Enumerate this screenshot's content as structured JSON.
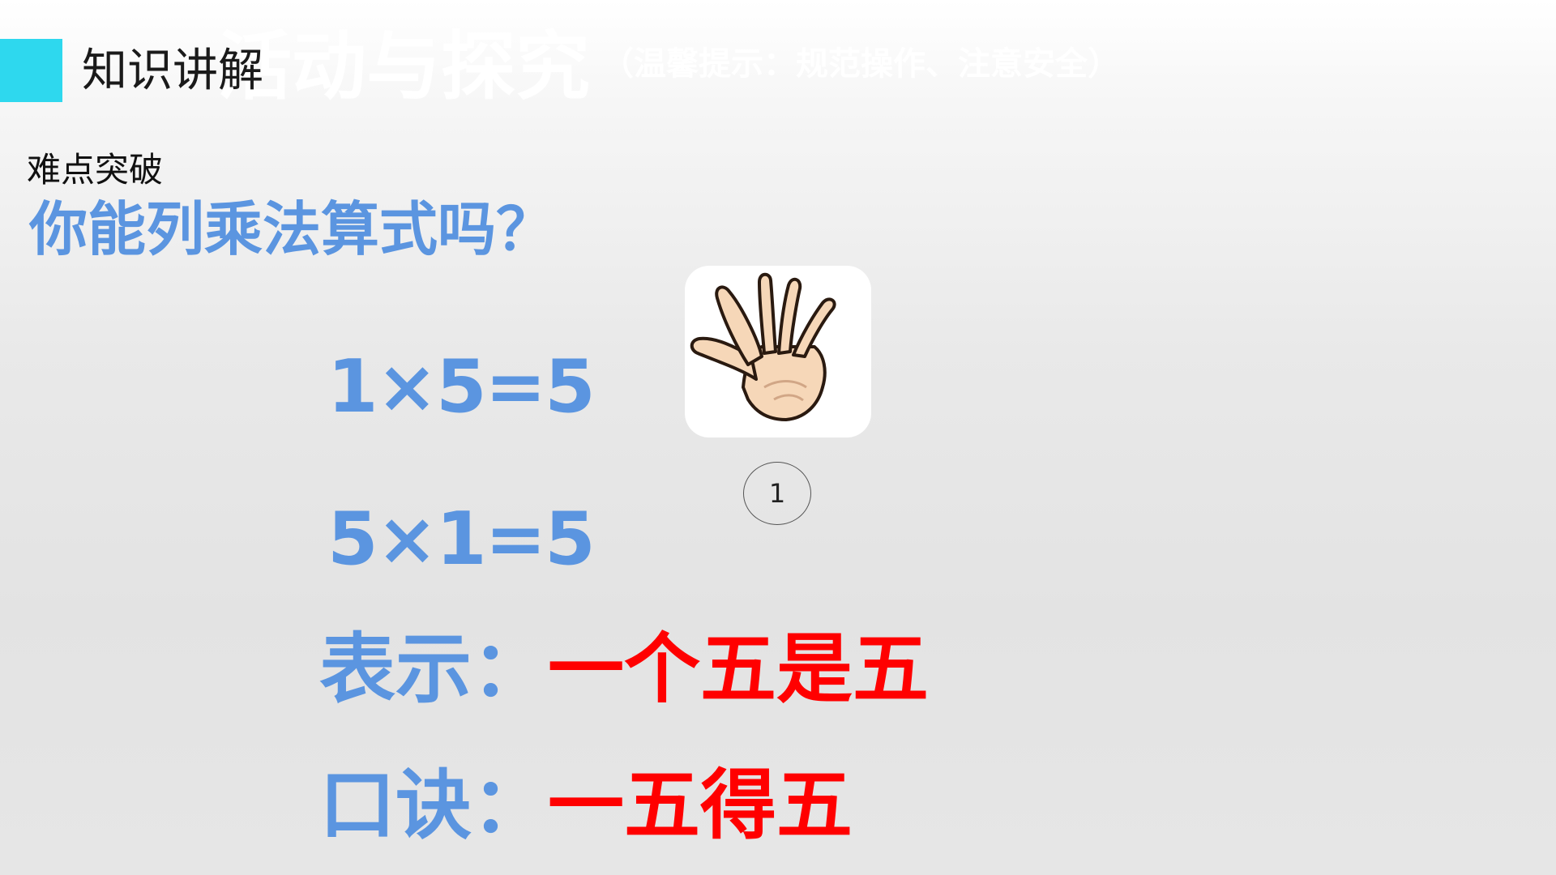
{
  "background_title": {
    "main": "活动与探究",
    "hint": "（温馨提示：规范操作、注意安全）"
  },
  "section": {
    "title": "知识讲解",
    "accent_color": "#2ed8ee"
  },
  "content": {
    "subheading": "难点突破",
    "question": "你能列乘法算式吗？",
    "equations": [
      "1×5=5",
      "5×1=5"
    ],
    "meaning": {
      "label": "表示：",
      "value": "一个五是五"
    },
    "rhyme": {
      "label": "口诀：",
      "value": "一五得五"
    }
  },
  "image": {
    "icon": "open-hand-five-fingers-icon",
    "badge_number": "1"
  },
  "colors": {
    "blue": "#5b95e0",
    "red": "#ff0000"
  }
}
